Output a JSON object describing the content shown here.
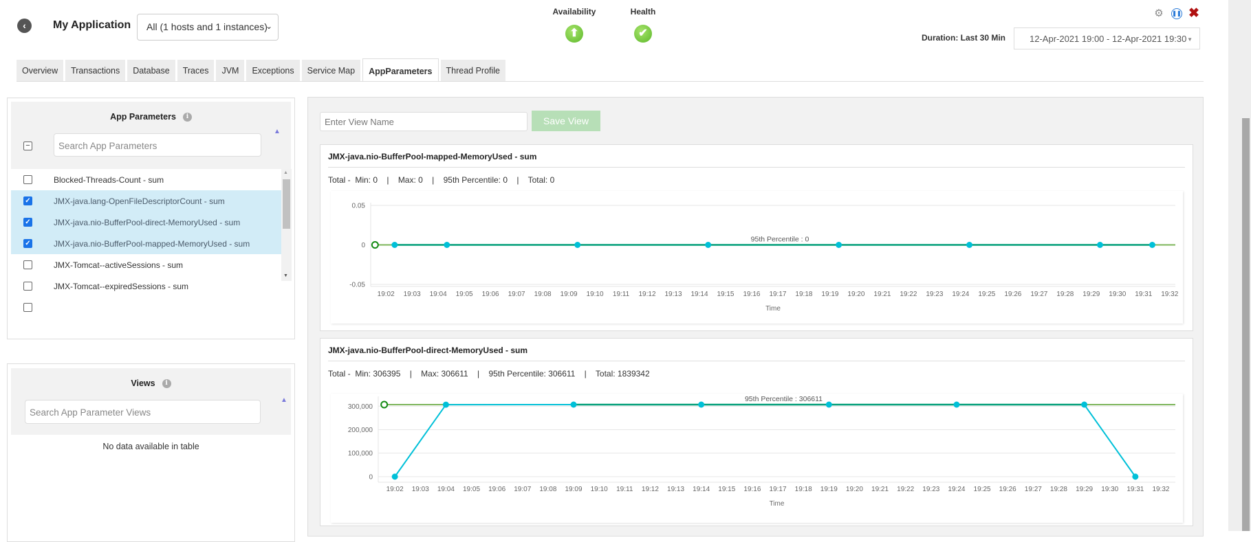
{
  "header": {
    "title": "My Application",
    "host_select": "All (1 hosts and 1 instances)",
    "availability": {
      "label": "Availability",
      "icon": "arrow-up-circle-icon"
    },
    "health": {
      "label": "Health",
      "icon": "check-circle-icon"
    },
    "duration_label": "Duration: Last 30 Min",
    "date_range": "12-Apr-2021 19:00 - 12-Apr-2021 19:30",
    "icons": [
      "settings-icon",
      "pause-icon",
      "close-icon"
    ]
  },
  "tabs": [
    {
      "label": "Overview"
    },
    {
      "label": "Transactions"
    },
    {
      "label": "Database"
    },
    {
      "label": "Traces"
    },
    {
      "label": "JVM"
    },
    {
      "label": "Exceptions"
    },
    {
      "label": "Service Map"
    },
    {
      "label": "AppParameters",
      "active": true
    },
    {
      "label": "Thread Profile"
    }
  ],
  "app_params": {
    "title": "App Parameters",
    "search_placeholder": "Search App Parameters",
    "items": [
      {
        "label": "Blocked-Threads-Count - sum",
        "checked": false
      },
      {
        "label": "JMX-java.lang-OpenFileDescriptorCount - sum",
        "checked": true
      },
      {
        "label": "JMX-java.nio-BufferPool-direct-MemoryUsed - sum",
        "checked": true
      },
      {
        "label": "JMX-java.nio-BufferPool-mapped-MemoryUsed - sum",
        "checked": true
      },
      {
        "label": "JMX-Tomcat--activeSessions - sum",
        "checked": false
      },
      {
        "label": "JMX-Tomcat--expiredSessions - sum",
        "checked": false
      }
    ]
  },
  "views": {
    "title": "Views",
    "search_placeholder": "Search App Parameter Views",
    "empty": "No data available in table"
  },
  "view_editor": {
    "placeholder": "Enter View Name",
    "save_label": "Save View"
  },
  "colors": {
    "series": "#00c0d8",
    "percentile": "#0a9a55",
    "save": "#b7dfb7"
  },
  "cards": [
    {
      "title": "JMX-java.nio-BufferPool-mapped-MemoryUsed - sum",
      "stats": "Total -  Min: 0    |    Max: 0    |    95th Percentile: 0    |    Total: 0"
    },
    {
      "title": "JMX-java.nio-BufferPool-direct-MemoryUsed - sum",
      "stats": "Total -  Min: 306395    |    Max: 306611    |    95th Percentile: 306611    |    Total: 1839342"
    }
  ],
  "chart_data": [
    {
      "type": "line",
      "xlabel": "Time",
      "ylabel": "",
      "xlim": [
        "19:01:25",
        "19:32:13"
      ],
      "ylim": [
        -0.05,
        0.05
      ],
      "yticks": [
        {
          "v": 0.05,
          "label": "0.05"
        },
        {
          "v": 0,
          "label": "0"
        },
        {
          "v": -0.05,
          "label": "-0.05"
        }
      ],
      "xticks": [
        "19:02",
        "19:03",
        "19:04",
        "19:05",
        "19:06",
        "19:07",
        "19:08",
        "19:09",
        "19:10",
        "19:11",
        "19:12",
        "19:13",
        "19:14",
        "19:15",
        "19:16",
        "19:17",
        "19:18",
        "19:19",
        "19:20",
        "19:21",
        "19:22",
        "19:23",
        "19:24",
        "19:25",
        "19:26",
        "19:27",
        "19:28",
        "19:29",
        "19:30",
        "19:31",
        "19:32"
      ],
      "x": [
        "19:02:20",
        "19:04:20",
        "19:09:20",
        "19:14:20",
        "19:19:20",
        "19:24:20",
        "19:29:20",
        "19:31:20"
      ],
      "values": [
        0,
        0,
        0,
        0,
        0,
        0,
        0,
        0
      ],
      "percentile": {
        "value": 0,
        "start": "19:01:35",
        "label": "95th Percentile : 0"
      },
      "grid": true
    },
    {
      "type": "line",
      "xlabel": "Time",
      "ylabel": "",
      "xlim": [
        "19:01:21",
        "19:32:34"
      ],
      "ylim": [
        -15000,
        330000
      ],
      "yticks": [
        {
          "v": 300000,
          "label": "300,000"
        },
        {
          "v": 200000,
          "label": "200,000"
        },
        {
          "v": 100000,
          "label": "100,000"
        },
        {
          "v": 0,
          "label": "0"
        }
      ],
      "xticks": [
        "19:02",
        "19:03",
        "19:04",
        "19:05",
        "19:06",
        "19:07",
        "19:08",
        "19:09",
        "19:10",
        "19:11",
        "19:12",
        "19:13",
        "19:14",
        "19:15",
        "19:16",
        "19:17",
        "19:18",
        "19:19",
        "19:20",
        "19:21",
        "19:22",
        "19:23",
        "19:24",
        "19:25",
        "19:26",
        "19:27",
        "19:28",
        "19:29",
        "19:30",
        "19:31",
        "19:32"
      ],
      "x": [
        "19:02",
        "19:04",
        "19:09",
        "19:14",
        "19:19",
        "19:24",
        "19:29",
        "19:31"
      ],
      "values": [
        0,
        306395,
        306611,
        306611,
        306611,
        306611,
        306611,
        0
      ],
      "percentile": {
        "value": 306611,
        "start": "19:01:35",
        "label": "95th Percentile : 306611"
      },
      "grid": true
    }
  ]
}
